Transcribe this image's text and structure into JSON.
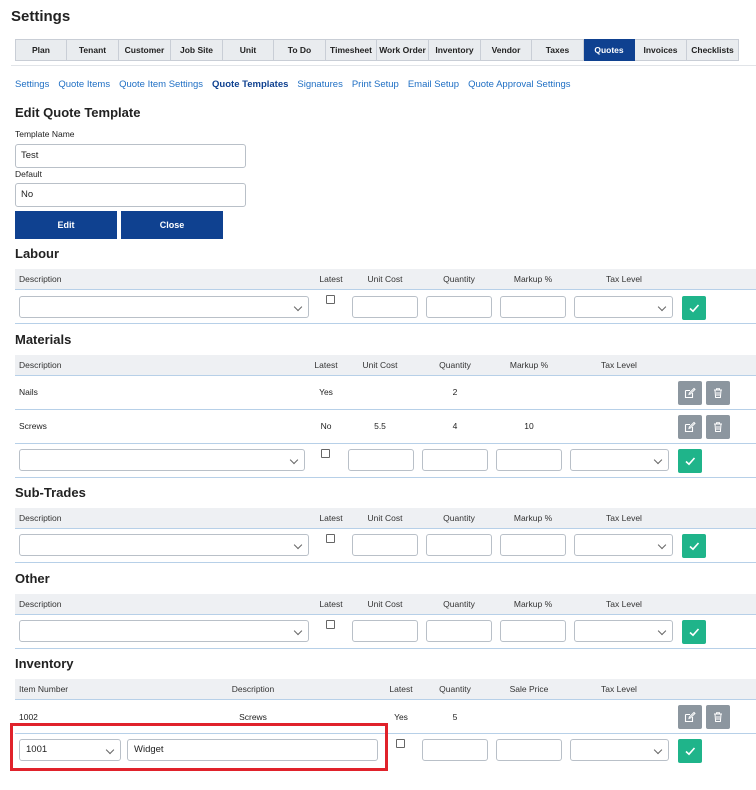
{
  "page": {
    "title": "Settings"
  },
  "tabs": [
    "Plan",
    "Tenant",
    "Customer",
    "Job Site",
    "Unit",
    "To Do",
    "Timesheet",
    "Work Order",
    "Inventory",
    "Vendor",
    "Taxes",
    "Quotes",
    "Invoices",
    "Checklists"
  ],
  "active_tab": "Quotes",
  "subnav": [
    "Settings",
    "Quote Items",
    "Quote Item Settings",
    "Quote Templates",
    "Signatures",
    "Print Setup",
    "Email Setup",
    "Quote Approval Settings"
  ],
  "active_subnav": "Quote Templates",
  "form": {
    "title": "Edit Quote Template",
    "template_name_label": "Template Name",
    "template_name_value": "Test",
    "default_label": "Default",
    "default_value": "No",
    "edit_label": "Edit",
    "close_label": "Close"
  },
  "columns": {
    "description": "Description",
    "latest": "Latest",
    "unit_cost": "Unit Cost",
    "quantity": "Quantity",
    "markup": "Markup %",
    "tax_level": "Tax Level"
  },
  "inventory_columns": {
    "item_number": "Item Number",
    "description": "Description",
    "latest": "Latest",
    "quantity": "Quantity",
    "sale_price": "Sale Price",
    "tax_level": "Tax Level"
  },
  "sections": {
    "labour": {
      "title": "Labour"
    },
    "materials": {
      "title": "Materials",
      "rows": [
        {
          "description": "Nails",
          "latest": "Yes",
          "unit_cost": "",
          "quantity": "2",
          "markup": ""
        },
        {
          "description": "Screws",
          "latest": "No",
          "unit_cost": "5.5",
          "quantity": "4",
          "markup": "10"
        }
      ]
    },
    "subtrades": {
      "title": "Sub-Trades"
    },
    "other": {
      "title": "Other"
    },
    "inventory": {
      "title": "Inventory",
      "rows": [
        {
          "item_number": "1002",
          "description": "Screws",
          "latest": "Yes",
          "quantity": "5"
        }
      ],
      "new_row": {
        "item_number": "1001",
        "description": "Widget"
      }
    }
  },
  "colors": {
    "primary": "#0f4190",
    "accent_green": "#1fb48a",
    "highlight_red": "#e0222b"
  }
}
